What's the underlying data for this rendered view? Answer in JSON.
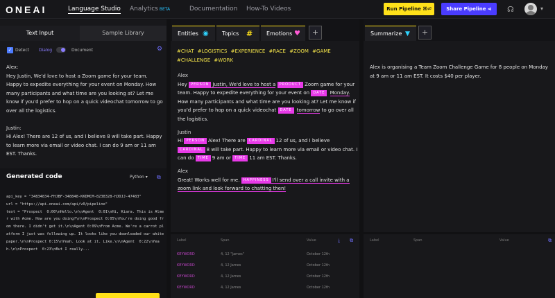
{
  "header": {
    "logo": "ONEAI",
    "nav": [
      {
        "label": "Language Studio"
      },
      {
        "label": "Analytics",
        "badge": "BETA"
      },
      {
        "label": "Documentation"
      },
      {
        "label": "How-To Videos"
      }
    ],
    "run_label": "Run Pipeline",
    "share_label": "Share Pipeline"
  },
  "left": {
    "tabs": [
      "Text Input",
      "Sample Library"
    ],
    "detect_label": "Detect",
    "dialog_label": "Dialog",
    "document_label": "Document",
    "input_text": "Alex:\nHey Justin, We'd love to host a Zoom game for your team. Happy to expedite everything for your event on Monday. How many participants and what time are you looking at? Let me know if you'd prefer to hop on a quick videochat tomorrow to go over all the logistics.\n\nJustin:\nHi Alex! There are 12 of us, and I believe 8 will take part. Happy to learn more via email or video chat. I can do 9 am or 11 am EST. Thanks.",
    "generated_title": "Generated code",
    "language": "Python",
    "code": "api_key = \"34834834-FHJBF-348848-KKDMCM-8238328-HJDJJ-47483\"\nurl = \"https://api.oneai.com/api/v0/pipeline\"\ntext = \"Prospect  0:00\\nHello.\\n\\nAgent  0:01\\nHi, Kiara. This is Almer with Acme. How are you doing?\\n\\nProspect 0:05\\nYou're doing good from there. I didn't get it.\\n\\nAgent 0:09\\nFrom Acme. We're a carrot platform I just was following up. It looks like you downloaded our whitepaper.\\n\\nProspect 0:15\\nYeah. Look at it. Like.\\n\\nAgent  0:22\\nYeah.\\n\\nProspect  0:23\\nBut I really..."
  },
  "middle": {
    "tabs": [
      {
        "label": "Entities"
      },
      {
        "label": "Topics"
      },
      {
        "label": "Emotions"
      }
    ],
    "tags": [
      "#CHAT",
      "#LOGISTICS",
      "#EXPERIENCE",
      "#RACE",
      "#ZOOM",
      "#GAME",
      "#CHALLENGE",
      "#WORK"
    ],
    "speaker1": "Alex",
    "speaker2": "Justin",
    "speaker3": "Alex",
    "entities": {
      "person": "PERSON",
      "product": "PRODUCT",
      "date": "DATE",
      "cardinal": "CARDINAL",
      "time": "TIME",
      "happiness": "HAPPINESS"
    },
    "t": {
      "a1": "Hey",
      "a2": "Justin, We'd love to host a",
      "a3": "Zoom game for your team. Happy to expedite everything for your event on",
      "a4": "Monday.",
      "a5": "How many participants and what time are you looking at? Let me know if you'd prefer to hop on a quick videochat",
      "a6": "tomorrow",
      "a7": "to go over all the logistics.",
      "b1": "Hi",
      "b2": "Alex! There are",
      "b3": "12",
      "b4": "of us, and I believe",
      "b5": "8",
      "b6": "will take part. Happy to learn more via email or video chat. I can do",
      "b7": "9 am",
      "b8": "or",
      "b9": "11 am",
      "b10": "EST. Thanks.",
      "c1": "Great! Works well for me.",
      "c2": "I'll send over a call invite with a zoom link and look forward to chatting then!"
    },
    "table": {
      "headers": [
        "Label",
        "Span",
        "Value"
      ],
      "rows": [
        {
          "label": "KEYWORD",
          "span": "4, 12 \"James\"",
          "value": "October 12th"
        },
        {
          "label": "KEYWORD",
          "span": "4, 12 James",
          "value": "October 12th"
        },
        {
          "label": "KEYWORD",
          "span": "4, 12 James",
          "value": "October 12th"
        },
        {
          "label": "KEYWORD",
          "span": "4, 12 James",
          "value": "October 12th"
        }
      ]
    }
  },
  "right": {
    "tab": "Summarize",
    "summary": "Alex is organising a Team Zoom Challenge Game for 8 people on Monday at 9 am or 11 am EST. It costs $40 per player.",
    "table": {
      "headers": [
        "Label",
        "Span",
        "Value"
      ]
    }
  }
}
